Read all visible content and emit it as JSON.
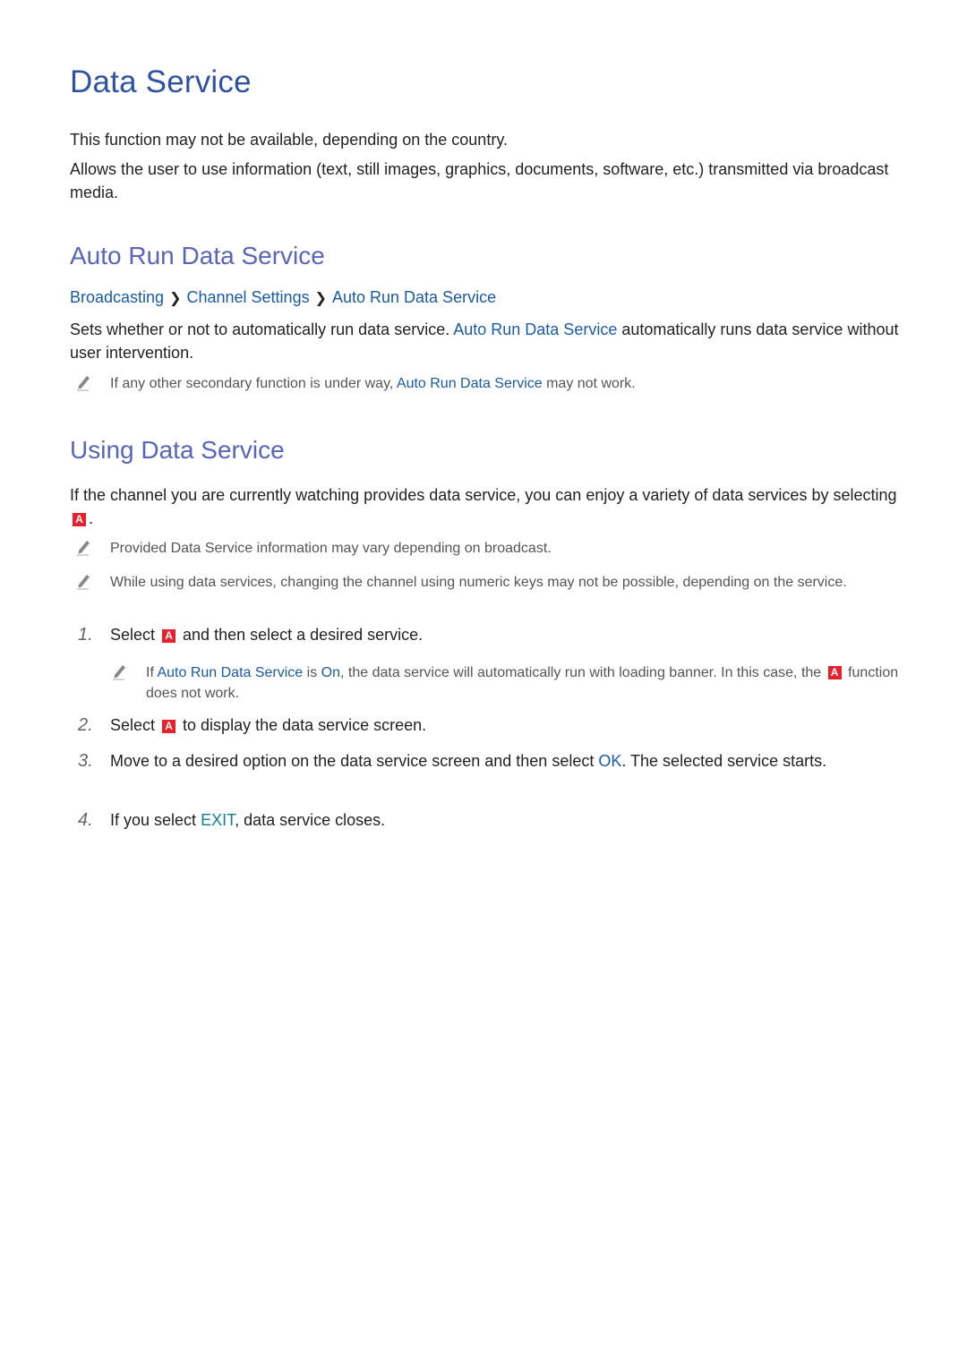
{
  "title": "Data Service",
  "intro": {
    "line1": "This function may not be available, depending on the country.",
    "line2": "Allows the user to use information (text, still images, graphics, documents, software, etc.) transmitted via broadcast media."
  },
  "auto_run": {
    "heading": "Auto Run Data Service",
    "breadcrumb": [
      "Broadcasting",
      "Channel Settings",
      "Auto Run Data Service"
    ],
    "body_pre": "Sets whether or not to automatically run data service. ",
    "body_link": "Auto Run Data Service",
    "body_post": " automatically runs data service without user intervention.",
    "note_pre": "If any other secondary function is under way, ",
    "note_link": "Auto Run Data Service",
    "note_post": " may not work."
  },
  "using": {
    "heading": "Using Data Service",
    "body_pre": "If the channel you are currently watching provides data service, you can enjoy a variety of data services by selecting ",
    "body_post": ".",
    "notes": [
      "Provided Data Service information may vary depending on broadcast.",
      "While using data services, changing the channel using numeric keys may not be possible, depending on the service."
    ],
    "steps": [
      {
        "num": "1.",
        "pre": "Select ",
        "post": " and then select a desired service."
      },
      {
        "num": "2.",
        "pre": "Select ",
        "post": " to display the data service screen."
      },
      {
        "num": "3.",
        "pre": "Move to a desired option on the data service screen and then select ",
        "link": "OK",
        "post": ". The selected service starts."
      },
      {
        "num": "4.",
        "pre": "If you select ",
        "link": "EXIT",
        "post": ", data service closes."
      }
    ],
    "step1_note": {
      "pre": "If ",
      "link1": "Auto Run Data Service",
      "mid": " is ",
      "link2": "On",
      "post1": ", the data service will automatically run with loading banner. In this case, the ",
      "post2": " function does not work."
    }
  },
  "key_label": "A",
  "colors": {
    "title": "#2f53a3",
    "heading": "#5865b8",
    "link": "#1a5ba6",
    "exit": "#12808f",
    "key_a": "#e8202a"
  }
}
